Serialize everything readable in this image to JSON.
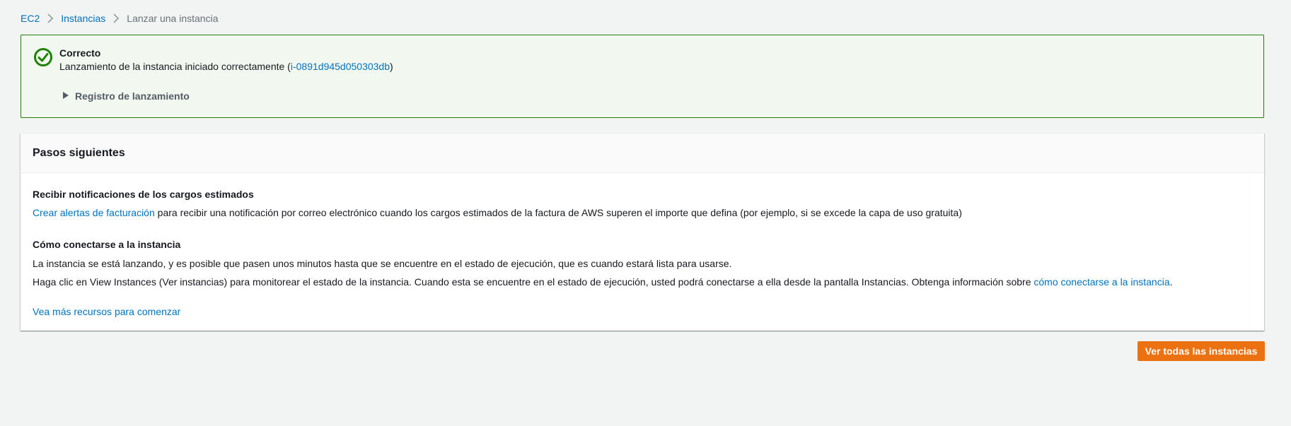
{
  "breadcrumb": {
    "items": [
      {
        "label": "EC2"
      },
      {
        "label": "Instancias"
      },
      {
        "label": "Lanzar una instancia"
      }
    ]
  },
  "flash": {
    "type": "success",
    "icon": "check-circle-icon",
    "title": "Correcto",
    "message_prefix": "Lanzamiento de la instancia iniciado correctamente (",
    "instance_id": "i-0891d945d050303db",
    "message_suffix": ")",
    "expander_label": "Registro de lanzamiento"
  },
  "next_steps": {
    "title": "Pasos siguientes",
    "billing": {
      "title": "Recibir notificaciones de los cargos estimados",
      "link": "Crear alertas de facturación",
      "text": " para recibir una notificación por correo electrónico cuando los cargos estimados de la factura de AWS superen el importe que defina (por ejemplo, si se excede la capa de uso gratuita)"
    },
    "connect": {
      "title": "Cómo conectarse a la instancia",
      "line1": "La instancia se está lanzando, y es posible que pasen unos minutos hasta que se encuentre en el estado de ejecución, que es cuando estará lista para usarse.",
      "line2_prefix": "Haga clic en View Instances (Ver instancias) para monitorear el estado de la instancia. Cuando esta se encuentre en el estado de ejecución, usted podrá conectarse a ella desde la pantalla Instancias. Obtenga información sobre ",
      "line2_link": "cómo conectarse a la instancia",
      "line2_suffix": "."
    },
    "more_resources": "Vea más recursos para comenzar"
  },
  "actions": {
    "view_all_label": "Ver todas las instancias"
  },
  "colors": {
    "background": "#f2f3f3",
    "link": "#0073bb",
    "success": "#1d8102",
    "success_bg": "#f2f8f0",
    "primary": "#ec7211"
  }
}
